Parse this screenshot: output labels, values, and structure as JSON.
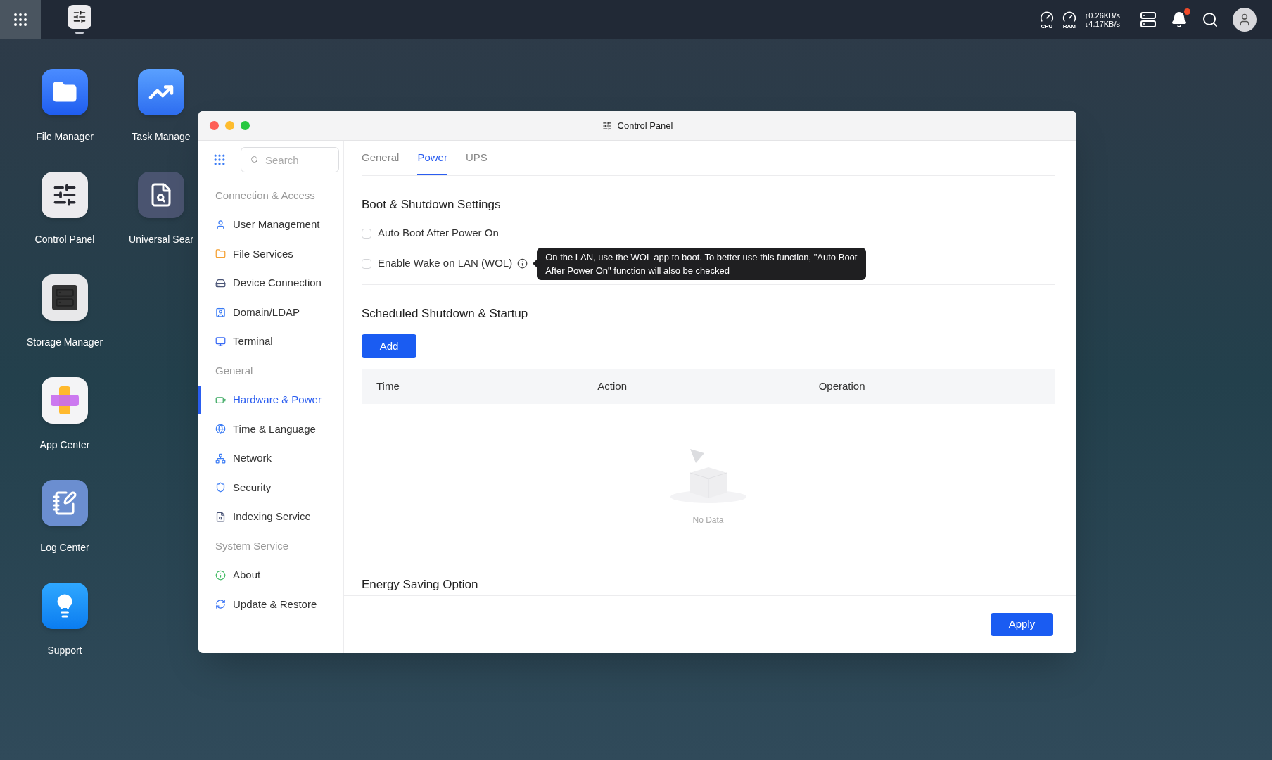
{
  "taskbar": {
    "apps": [
      {
        "kind": "control_panel",
        "selected": true
      }
    ]
  },
  "status": {
    "cpu_label": "CPU",
    "ram_label": "RAM",
    "upload": "↑0.26KB/s",
    "download": "↓4.17KB/s",
    "notifications_unread": true
  },
  "desktop_columns": [
    {
      "icons": [
        {
          "label": "File Manager",
          "kind": "file_manager"
        },
        {
          "label": "Control Panel",
          "kind": "control_panel"
        },
        {
          "label": "Storage Manager",
          "kind": "storage"
        },
        {
          "label": "App Center",
          "kind": "app_center"
        },
        {
          "label": "Log Center",
          "kind": "log"
        },
        {
          "label": "Support",
          "kind": "support"
        }
      ]
    },
    {
      "icons": [
        {
          "label": "Task Manage",
          "kind": "task"
        },
        {
          "label": "Universal Sear",
          "kind": "search"
        }
      ]
    }
  ],
  "window": {
    "title": "Control Panel",
    "sidebar": {
      "search": {
        "placeholder": "Search"
      },
      "sections": [
        {
          "title": "Connection & Access",
          "items": [
            {
              "label": "User Management",
              "kind": "user",
              "selected": false
            },
            {
              "label": "File Services",
              "kind": "folder",
              "selected": false
            },
            {
              "label": "Device Connection",
              "kind": "device",
              "selected": false
            },
            {
              "label": "Domain/LDAP",
              "kind": "domain",
              "selected": false
            },
            {
              "label": "Terminal",
              "kind": "terminal",
              "selected": false
            }
          ]
        },
        {
          "title": "General",
          "items": [
            {
              "label": "Hardware & Power",
              "kind": "hardware",
              "selected": true
            },
            {
              "label": "Time & Language",
              "kind": "globe",
              "selected": false
            },
            {
              "label": "Network",
              "kind": "network",
              "selected": false
            },
            {
              "label": "Security",
              "kind": "shield",
              "selected": false
            },
            {
              "label": "Indexing Service",
              "kind": "index",
              "selected": false
            }
          ]
        },
        {
          "title": "System Service",
          "items": [
            {
              "label": "About",
              "kind": "info",
              "selected": false
            },
            {
              "label": "Update & Restore",
              "kind": "sync",
              "selected": false
            }
          ]
        }
      ]
    },
    "tabs": [
      {
        "label": "General",
        "selected": false
      },
      {
        "label": "Power",
        "selected": true
      },
      {
        "label": "UPS",
        "selected": false
      }
    ],
    "boot": {
      "heading": "Boot & Shutdown Settings",
      "options": [
        {
          "label": "Auto Boot After Power On",
          "checked": false
        },
        {
          "label": "Enable Wake on LAN (WOL)",
          "checked": false,
          "tooltip": "On the LAN, use the WOL app to boot. To better use this function, \"Auto Boot After Power On\" function will also be checked"
        }
      ]
    },
    "schedule": {
      "heading": "Scheduled Shutdown & Startup",
      "add_button": "Add",
      "columns": [
        "Time",
        "Action",
        "Operation"
      ],
      "empty_text": "No Data"
    },
    "energy_heading": "Energy Saving Option",
    "apply_button": "Apply"
  }
}
